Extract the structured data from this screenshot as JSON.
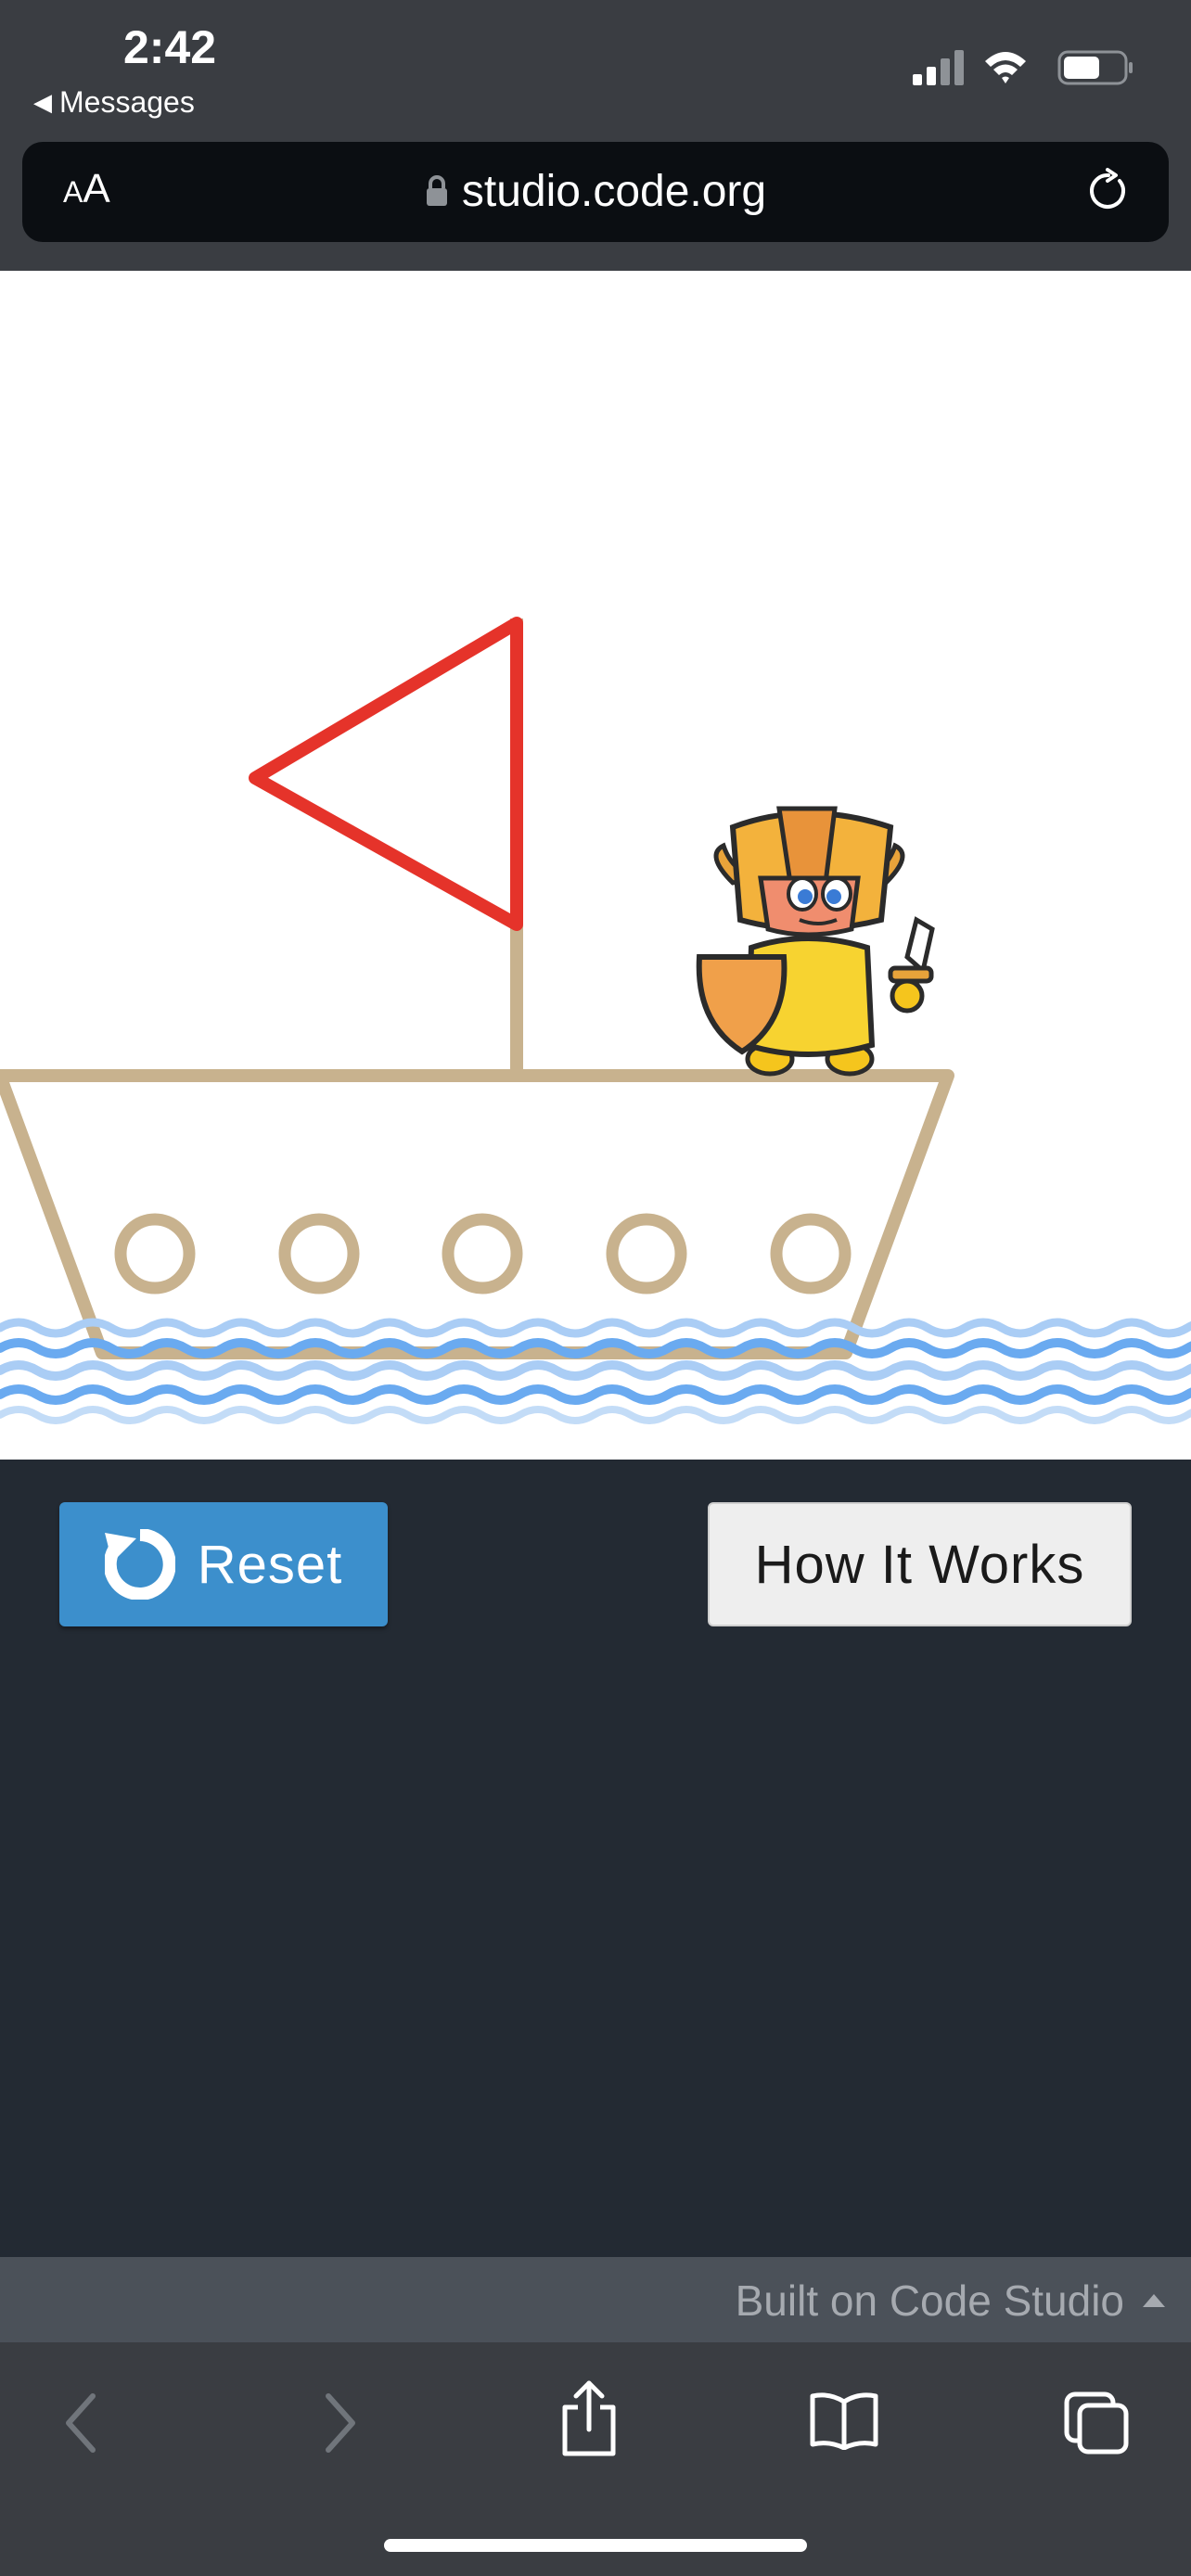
{
  "status_bar": {
    "time": "2:42",
    "back_label": "Messages",
    "icons": [
      "cellular-signal-icon",
      "wifi-icon",
      "battery-icon"
    ]
  },
  "browser": {
    "text_size_label_small": "A",
    "text_size_label_large": "A",
    "url": "studio.code.org"
  },
  "buttons": {
    "reset_label": "Reset",
    "how_it_works_label": "How It Works"
  },
  "footer": {
    "built_on_label": "Built on Code Studio"
  },
  "toolbar": {
    "icons": [
      "back-icon",
      "forward-icon",
      "share-icon",
      "bookmarks-icon",
      "tabs-icon"
    ]
  },
  "colors": {
    "reset_button": "#3c8fcc",
    "stage_background": "#ffffff",
    "page_background": "#232a33",
    "sail": "#e5332a",
    "ship": "#c8b28e",
    "water": "#6aaaf0"
  }
}
